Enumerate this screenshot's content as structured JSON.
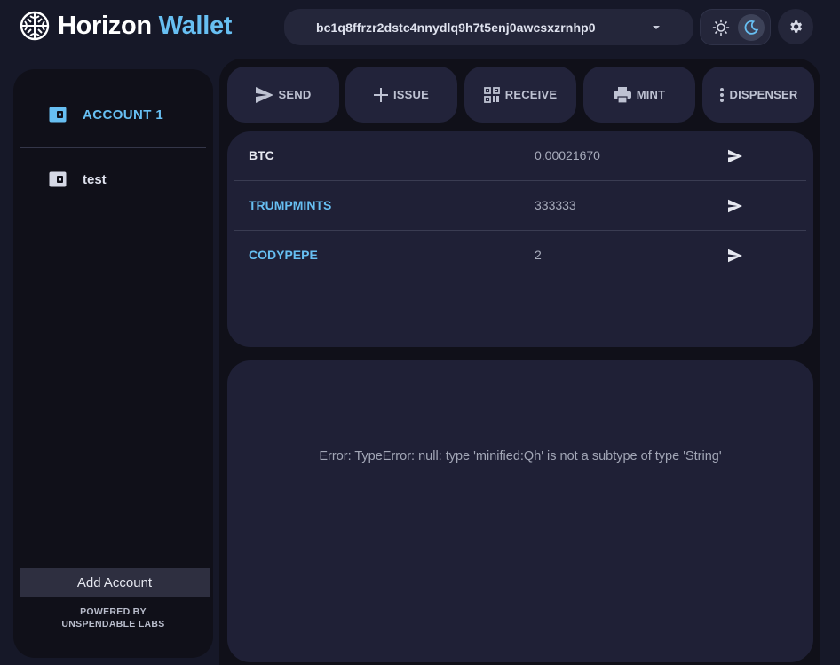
{
  "header": {
    "brand_word1": "Horizon",
    "brand_word2": "Wallet",
    "address": "bc1q8ffrzr2dstc4nnydlq9h7t5enj0awcsxzrnhp0",
    "theme_selected": "dark"
  },
  "sidebar": {
    "accounts": [
      {
        "label": "ACCOUNT 1",
        "active": true
      },
      {
        "label": "test",
        "active": false
      }
    ],
    "add_account_label": "Add Account",
    "powered_line1": "POWERED BY",
    "powered_line2": "UNSPENDABLE LABS"
  },
  "toolbar": {
    "send": "SEND",
    "issue": "ISSUE",
    "receive": "RECEIVE",
    "mint": "MINT",
    "dispenser": "DISPENSER"
  },
  "assets": [
    {
      "name": "BTC",
      "quantity": "0.00021670"
    },
    {
      "name": "TRUMPMINTS",
      "quantity": "333333"
    },
    {
      "name": "CODYPEPE",
      "quantity": "2"
    }
  ],
  "history": {
    "error_message": "Error: TypeError: null: type 'minified:Qh' is not a subtype of type 'String'"
  },
  "colors": {
    "accent": "#67bff2",
    "background": "#161828",
    "panel": "#101019",
    "card": "#1f2036"
  },
  "icons": {
    "logo": "horizon-logo-icon",
    "sun": "sun-icon",
    "moon": "moon-icon",
    "settings": "gear-icon",
    "wallet": "wallet-icon",
    "send": "send-icon",
    "issue": "plus-icon",
    "receive": "qr-code-icon",
    "mint": "printer-icon",
    "dispenser": "more-vertical-icon"
  }
}
